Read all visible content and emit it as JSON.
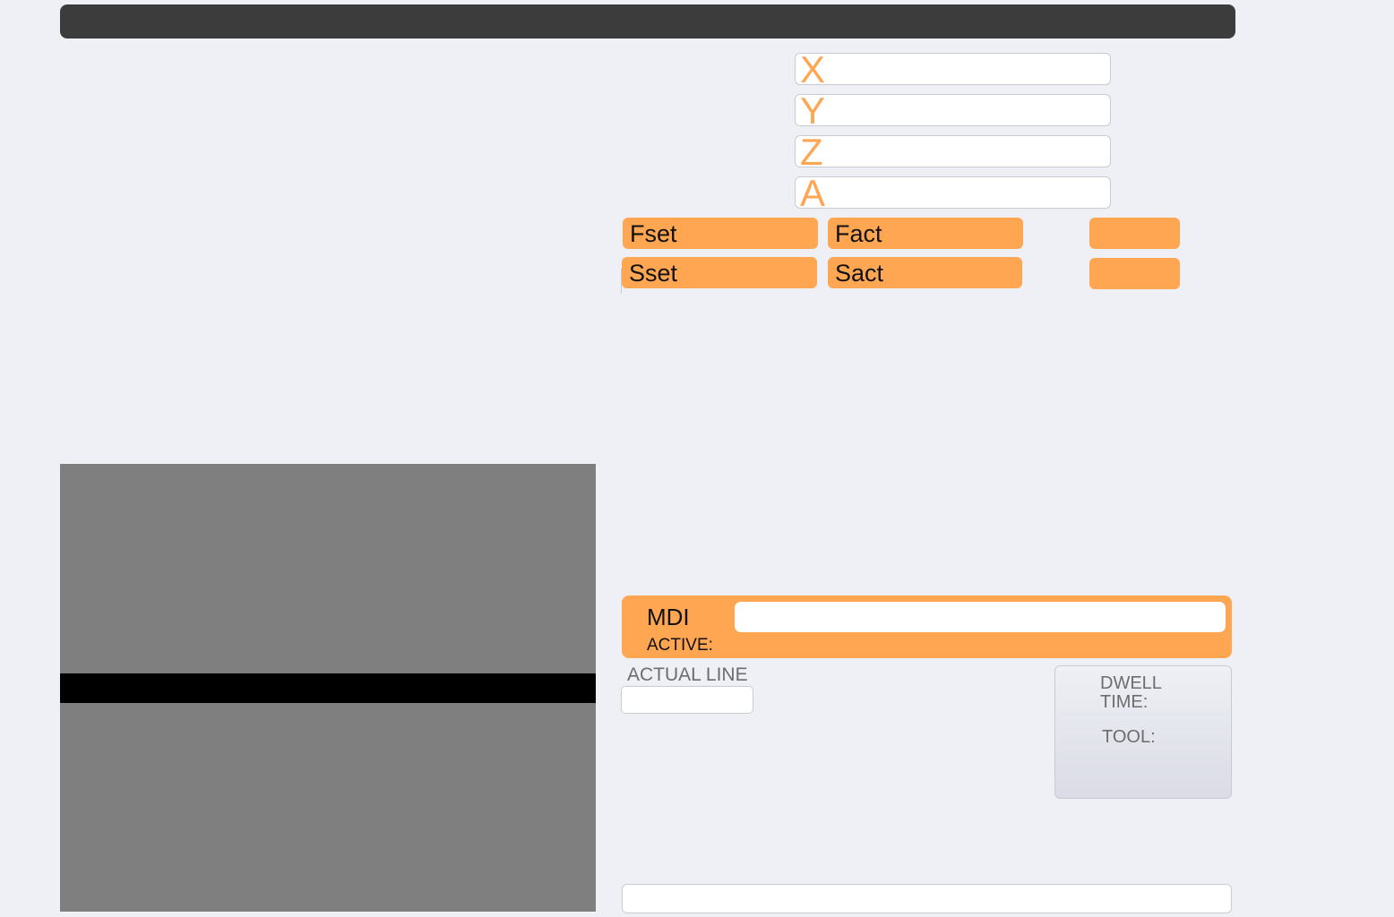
{
  "axes": [
    {
      "letter": "X",
      "value": ""
    },
    {
      "letter": "Y",
      "value": ""
    },
    {
      "letter": "Z",
      "value": ""
    },
    {
      "letter": "A",
      "value": ""
    }
  ],
  "feed": {
    "fset_label": "Fset",
    "fset_value": "",
    "fact_label": "Fact",
    "fact_value": ""
  },
  "spindle": {
    "sset_label": "Sset",
    "sset_value": "",
    "sact_label": "Sact",
    "sact_value": ""
  },
  "buttons": {
    "top_label": "",
    "bottom_label": ""
  },
  "mdi": {
    "label": "MDI",
    "active_label": "ACTIVE:",
    "input_value": ""
  },
  "actual_line": {
    "label": "ACTUAL LINE",
    "value": ""
  },
  "info": {
    "dwell_label": "DWELL\nTIME:",
    "tool_label": "TOOL:"
  },
  "status": {
    "text": ""
  },
  "colors": {
    "accent": "#ffa652",
    "title_bar": "#3c3c3c",
    "background": "#eef0f5",
    "preview": "#7f7f7f"
  }
}
